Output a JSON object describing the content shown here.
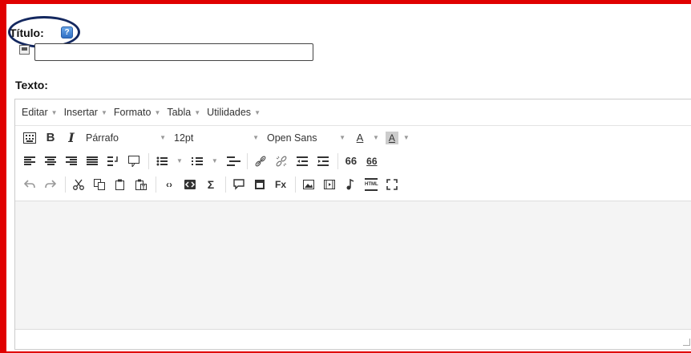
{
  "title_field": {
    "label": "Título:",
    "help_icon": "help-icon",
    "value": ""
  },
  "text_field": {
    "label": "Texto:"
  },
  "editor": {
    "menu": [
      {
        "label": "Editar"
      },
      {
        "label": "Insertar"
      },
      {
        "label": "Formato"
      },
      {
        "label": "Tabla"
      },
      {
        "label": "Utilidades"
      }
    ],
    "toolbar1": {
      "bold": "B",
      "italic": "I",
      "paragraph": "Párrafo",
      "font_size": "12pt",
      "font_family": "Open Sans",
      "text_color": "A",
      "bg_color": "A"
    },
    "toolbar2": {
      "blockquote": "66",
      "quote_inline": "66"
    },
    "toolbar3": {
      "sigma": "Σ",
      "fx": "Fx",
      "html": "HTML"
    }
  },
  "colors": {
    "frame": "#e00000",
    "circle": "#14285f"
  }
}
